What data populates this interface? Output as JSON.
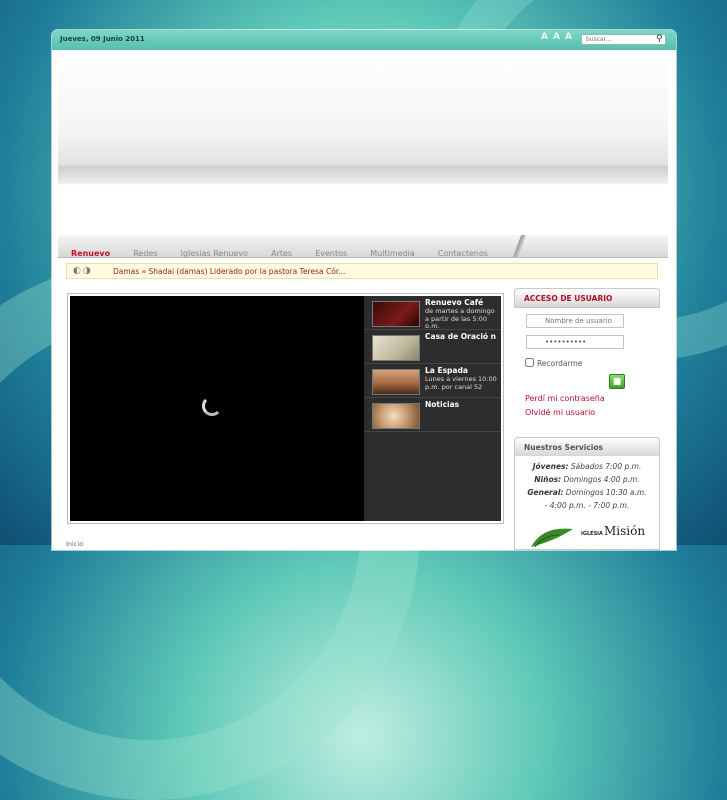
{
  "header": {
    "date": "Jueves, 09 Junio 2011",
    "font_size_controls": [
      "A",
      "A",
      "A"
    ],
    "search_placeholder": "buscar..."
  },
  "nav": {
    "items": [
      "Renuevo",
      "Redes",
      "Iglesias Renuevo",
      "Artes",
      "Eventos",
      "Multimedia",
      "Contactenos"
    ]
  },
  "ticker": {
    "text": "Damas » Shadai (damas) Liderado por la pastora Teresa Cór..."
  },
  "playlist": [
    {
      "title": "Renuevo Café",
      "desc": "de martes a domingo a partir de las 5:00 p.m."
    },
    {
      "title": "Casa de Oració n",
      "desc": ""
    },
    {
      "title": "La Espada",
      "desc": "Lunes a viernes 10:00 p.m. por canal 52"
    },
    {
      "title": "Noticias",
      "desc": ""
    }
  ],
  "breadcrumb": "Inicio",
  "login": {
    "title": "ACCESO DE USUARIO",
    "username_placeholder": "Nombre de usuario",
    "password_value": "••••••••••",
    "remember_label": "Recordarme",
    "forgot_password": "Perdí mi contraseña",
    "forgot_username": "Olvidé mi usuario"
  },
  "services": {
    "title": "Nuestros Servicios",
    "lines": [
      {
        "label": "Jóvenes:",
        "text": "Sábados 7:00 p.m."
      },
      {
        "label": "Niños:",
        "text": "Domingos 4:00 p.m."
      },
      {
        "label": "General:",
        "text": "Domingos 10:30 a.m."
      },
      {
        "label": "",
        "text": "- 4:00 p.m. - 7:00 p.m."
      }
    ],
    "logo_small": "IGLESIA",
    "logo_big": "Misión"
  },
  "colors": {
    "accent": "#c0102a",
    "topbar": "#56bfae"
  },
  "icons": {
    "search": "magnifier-icon",
    "user": "user-icon",
    "password": "key-icon",
    "login": "lock-icon"
  }
}
